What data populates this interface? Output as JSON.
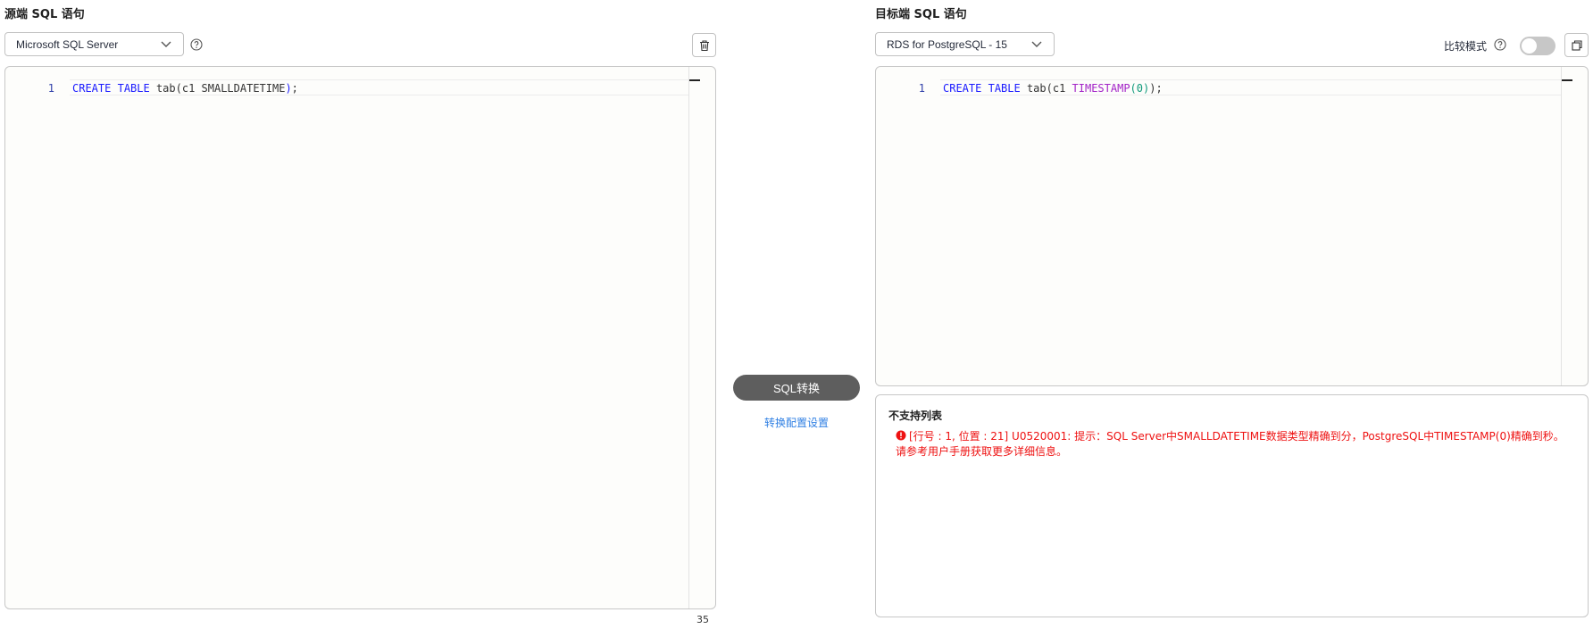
{
  "source": {
    "title": "源端 SQL 语句",
    "dialect": "Microsoft SQL Server",
    "editor": {
      "line_number": "1",
      "tokens": [
        {
          "text": "CREATE",
          "class": "kw"
        },
        {
          "text": " ",
          "class": "pn"
        },
        {
          "text": "TABLE",
          "class": "kw"
        },
        {
          "text": " tab(c1 SMALLDATETIME",
          "class": "pn"
        },
        {
          "text": ")",
          "class": "kw"
        },
        {
          "text": ";",
          "class": "pn"
        }
      ]
    },
    "char_count": "35"
  },
  "target": {
    "title": "目标端 SQL 语句",
    "dialect": "RDS for PostgreSQL - 15",
    "compare_mode_label": "比较模式",
    "compare_mode_on": false,
    "editor": {
      "line_number": "1",
      "tokens": [
        {
          "text": "CREATE",
          "class": "kw"
        },
        {
          "text": " ",
          "class": "pn"
        },
        {
          "text": "TABLE",
          "class": "kw"
        },
        {
          "text": " tab(c1 ",
          "class": "pn"
        },
        {
          "text": "TIMESTAMP",
          "class": "fn"
        },
        {
          "text": "(",
          "class": "num"
        },
        {
          "text": "0",
          "class": "num"
        },
        {
          "text": ")",
          "class": "num"
        },
        {
          "text": ");",
          "class": "pn"
        }
      ]
    }
  },
  "actions": {
    "convert_label": "SQL转换",
    "config_link": "转换配置设置"
  },
  "unsupported": {
    "title": "不支持列表",
    "items": [
      "[行号 : 1, 位置 : 21] U0520001: 提示：SQL Server中SMALLDATETIME数据类型精确到分，PostgreSQL中TIMESTAMP(0)精确到秒。请参考用户手册获取更多详细信息。"
    ]
  },
  "icons": {
    "chevron": "chevron-down-icon",
    "help": "help-circle-icon",
    "delete": "trash-icon",
    "copy": "copy-icon",
    "error": "error-circle-icon"
  },
  "colors": {
    "keyword": "#1a1aff",
    "function": "#a323c7",
    "number": "#0f9a7b",
    "error": "#ee1111",
    "link": "#2f7fe3",
    "button": "#5e5e5e"
  }
}
